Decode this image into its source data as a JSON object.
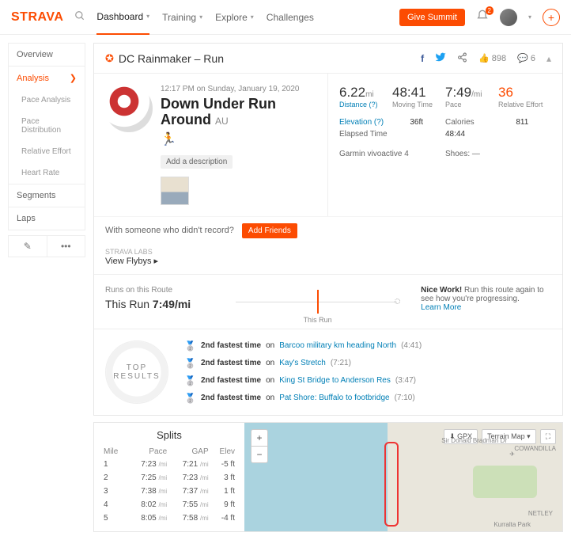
{
  "brand": "STRAVA",
  "nav": {
    "dashboard": "Dashboard",
    "training": "Training",
    "explore": "Explore",
    "challenges": "Challenges",
    "summit": "Give Summit",
    "notif_count": "2"
  },
  "sidebar": {
    "overview": "Overview",
    "analysis": "Analysis",
    "pace_analysis": "Pace Analysis",
    "pace_dist": "Pace Distribution",
    "rel_effort": "Relative Effort",
    "hr": "Heart Rate",
    "segments": "Segments",
    "laps": "Laps"
  },
  "header": {
    "athlete": "DC Rainmaker",
    "sep": " – ",
    "type": "Run",
    "kudos": "898",
    "comments": "6"
  },
  "activity": {
    "datetime": "12:17 PM on Sunday, January 19, 2020",
    "title_main": "Down Under Run Around",
    "title_suffix": "AU",
    "add_desc": "Add a description"
  },
  "stats": {
    "distance_v": "6.22",
    "distance_u": "mi",
    "distance_l": "Distance (?)",
    "moving_v": "48:41",
    "moving_l": "Moving Time",
    "pace_v": "7:49",
    "pace_u": "/mi",
    "pace_l": "Pace",
    "effort_v": "36",
    "effort_l": "Relative Effort",
    "elev_k": "Elevation (?)",
    "elev_v": "36ft",
    "cal_k": "Calories",
    "cal_v": "811",
    "elapsed_k": "Elapsed Time",
    "elapsed_v": "48:44",
    "device": "Garmin vivoactive 4",
    "shoes_k": "Shoes:",
    "shoes_v": "—"
  },
  "someone": {
    "q": "With someone who didn't record?",
    "btn": "Add Friends",
    "labs": "STRAVA LABS",
    "flyby": "View Flybys"
  },
  "route": {
    "lbl": "Runs on this Route",
    "this_run": "This Run",
    "pace": "7:49/mi",
    "marker": "This Run",
    "nice_b": "Nice Work!",
    "nice_t": " Run this route again to see how you're progressing.",
    "learn": "Learn More"
  },
  "top_results": {
    "label": "TOP\nRESULTS",
    "prefix": "2nd fastest time",
    "on": " on ",
    "items": [
      {
        "name": "Barcoo military km heading North",
        "time": "(4:41)"
      },
      {
        "name": "Kay's Stretch",
        "time": "(7:21)"
      },
      {
        "name": "King St Bridge to Anderson Res",
        "time": "(3:47)"
      },
      {
        "name": "Pat Shore: Buffalo to footbridge",
        "time": "(7:10)"
      }
    ]
  },
  "splits": {
    "title": "Splits",
    "cols": {
      "mile": "Mile",
      "pace": "Pace",
      "gap": "GAP",
      "elev": "Elev"
    },
    "rows": [
      {
        "m": "1",
        "p": "7:23",
        "g": "7:21",
        "e": "-5 ft"
      },
      {
        "m": "2",
        "p": "7:25",
        "g": "7:23",
        "e": "3 ft"
      },
      {
        "m": "3",
        "p": "7:38",
        "g": "7:37",
        "e": "1 ft"
      },
      {
        "m": "4",
        "p": "8:02",
        "g": "7:55",
        "e": "9 ft"
      },
      {
        "m": "5",
        "p": "8:05",
        "g": "7:58",
        "e": "-4 ft"
      }
    ],
    "unit": "/mi"
  },
  "map": {
    "gpx": "GPX",
    "terrain": "Terrain Map",
    "place1": "Sir Donald Bradman Dr",
    "place2": "COWANDILLA",
    "place3": "NETLEY",
    "place4": "Kurralta Park"
  }
}
